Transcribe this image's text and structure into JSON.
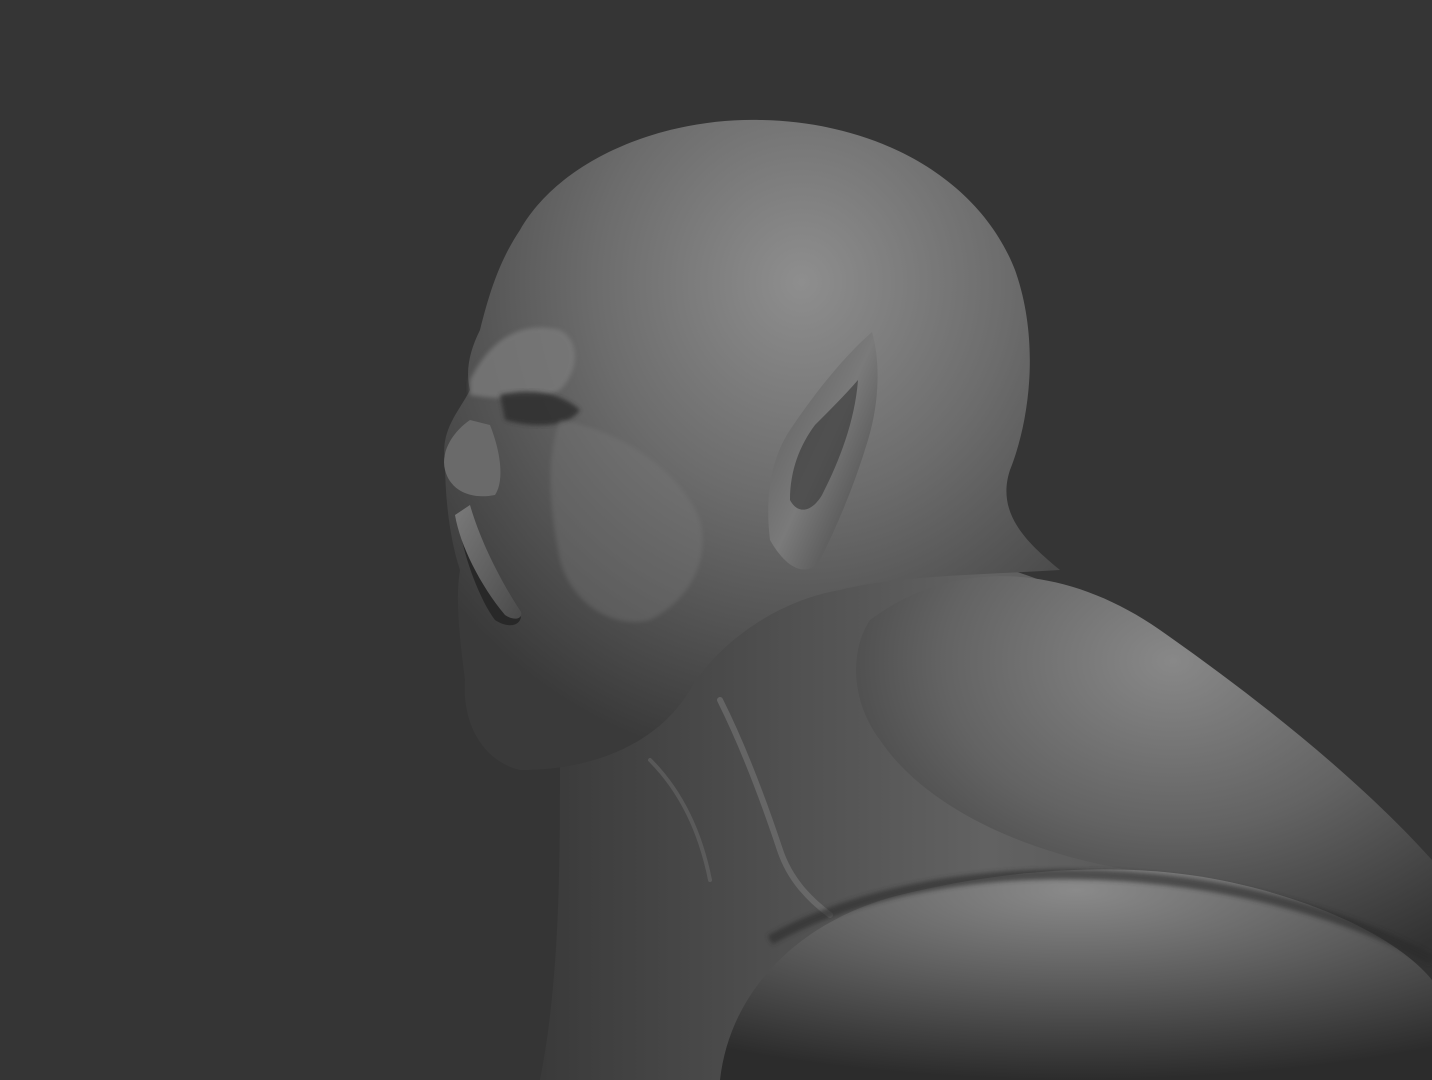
{
  "scene": {
    "background_color": "#353535",
    "subject": "orc-bust-sculpt-icon",
    "material_colors": {
      "highlight": "#8a8a8a",
      "mid": "#5e5e5e",
      "shadow": "#2e2e2e",
      "tusk": "#6f6f6f"
    }
  }
}
